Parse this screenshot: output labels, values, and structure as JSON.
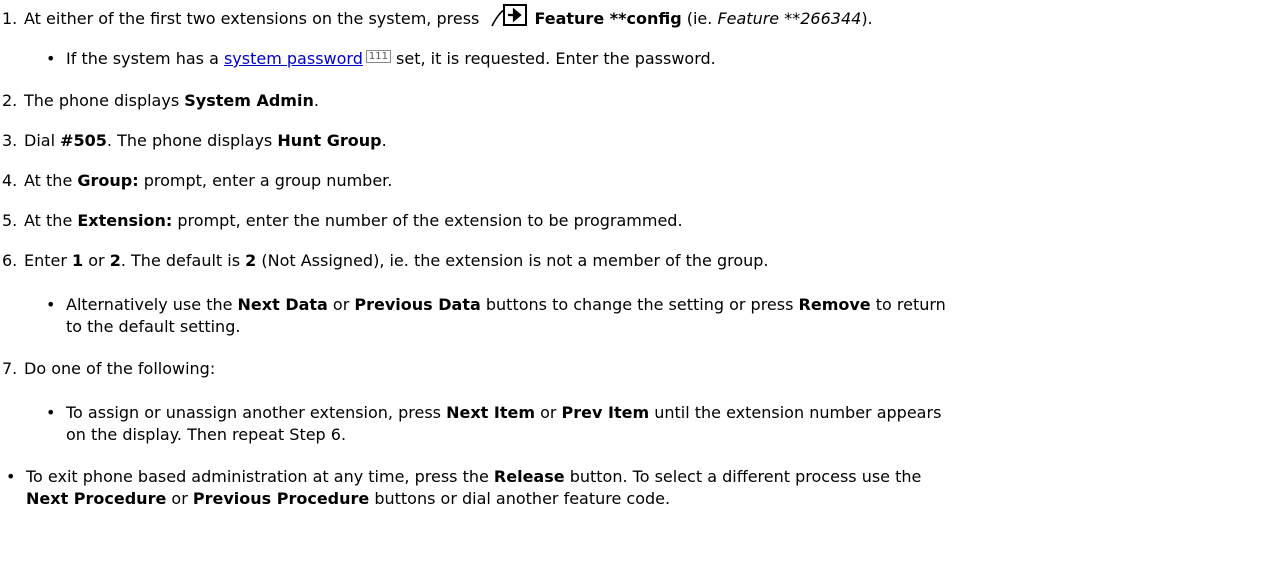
{
  "top_clipped": "",
  "steps": [
    {
      "num": "1.",
      "parts": [
        "At either of the first two extensions on the system, press ",
        "Feature **config",
        " (ie. ",
        "Feature **266344",
        ")."
      ]
    },
    {
      "bullet": "If the system has a ",
      "link": "system password",
      "ref": "111",
      "rest": " set, it is requested. Enter the password."
    },
    {
      "num": "2.",
      "parts": [
        "The phone displays ",
        "System Admin",
        "."
      ]
    },
    {
      "num": "3.",
      "parts": [
        "Dial ",
        "#505",
        ". The phone displays ",
        "Hunt Group",
        "."
      ]
    },
    {
      "num": "4.",
      "parts": [
        "At the ",
        "Group:",
        " prompt, enter a group number."
      ]
    },
    {
      "num": "5.",
      "parts": [
        "At the ",
        "Extension:",
        " prompt, enter the number of the extension to be programmed."
      ]
    },
    {
      "num": "6.",
      "parts": [
        "Enter ",
        "1",
        " or ",
        "2",
        ". The default is ",
        "2",
        " (Not Assigned), ie. the extension is not a member of the group."
      ]
    },
    {
      "bullet_parts": [
        "Alternatively use the ",
        "Next Data",
        " or ",
        "Previous Data",
        " buttons to change the setting or press ",
        "Remove",
        " to return"
      ],
      "cont": "to the default setting."
    },
    {
      "num": "7.",
      "parts": [
        "Do one of the following:"
      ]
    },
    {
      "bullet_parts": [
        "To assign or unassign another extension, press ",
        "Next Item",
        " or ",
        "Prev Item",
        " until the extension number appears"
      ],
      "cont": "on the display. Then repeat Step 6."
    },
    {
      "bullet_parts": [
        "To exit phone based administration at any time, press the ",
        "Release",
        " button. To select a different process use the"
      ],
      "cont_parts": [
        "Next Procedure",
        " or ",
        "Previous Procedure",
        " buttons or dial another feature code."
      ]
    }
  ],
  "icons": {
    "feature": "feature-arrow-icon"
  },
  "colors": {
    "link": "#0000cc"
  }
}
